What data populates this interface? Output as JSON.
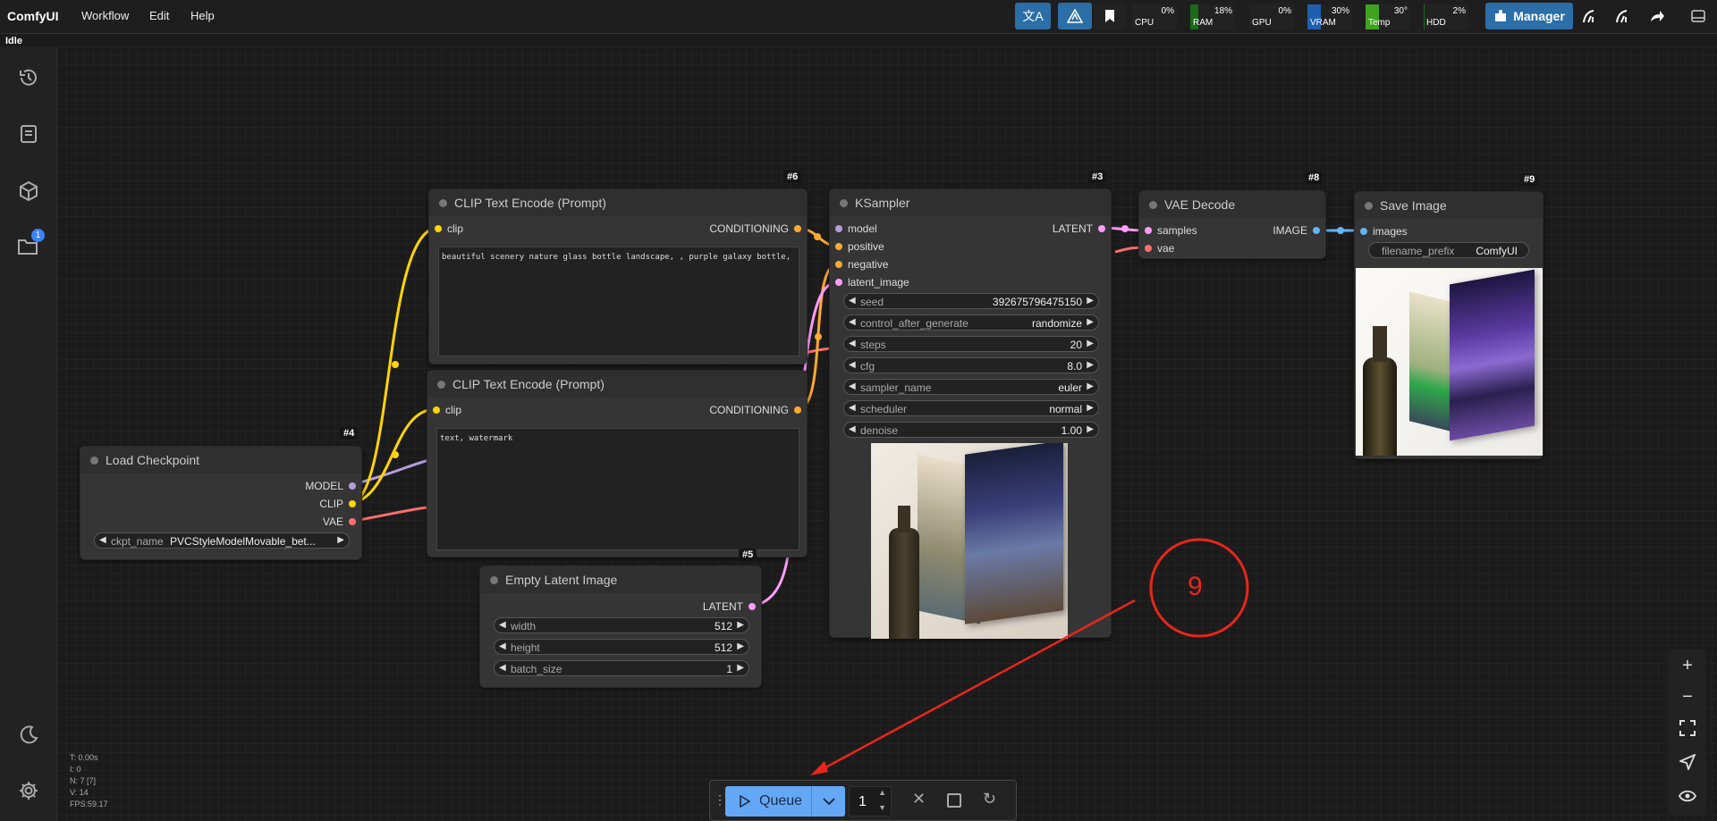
{
  "app": {
    "brand": "ComfyUI",
    "status": "Idle"
  },
  "menu": {
    "workflow": "Workflow",
    "edit": "Edit",
    "help": "Help"
  },
  "monitor": {
    "cpu": {
      "label": "CPU",
      "value": "0%",
      "level": 0.0,
      "color": "#1a7a1a"
    },
    "ram": {
      "label": "RAM",
      "value": "18%",
      "level": 0.18,
      "color": "#1a6a1a"
    },
    "gpu": {
      "label": "GPU",
      "value": "0%",
      "level": 0.0,
      "color": "#1a7a1a"
    },
    "vram": {
      "label": "VRAM",
      "value": "30%",
      "level": 0.3,
      "color": "#1e5fb0"
    },
    "temp": {
      "label": "Temp",
      "value": "30°",
      "level": 0.3,
      "color": "#3fa31f"
    },
    "hdd": {
      "label": "HDD",
      "value": "2%",
      "level": 0.02,
      "color": "#1a6a1a"
    }
  },
  "manager": {
    "label": "Manager"
  },
  "colors": {
    "clip": "#ffd500",
    "conditioning": "#ffa931",
    "model": "#b39ddb",
    "latent": "#ff9cf9",
    "vae": "#ff6e6e",
    "image": "#64b5f6",
    "annotation": "#e8261b",
    "queue": "#64a8f5"
  },
  "nodes": {
    "clip_pos": {
      "id": "#6",
      "title": "CLIP Text Encode (Prompt)",
      "in": "clip",
      "out": "CONDITIONING",
      "text": "beautiful scenery nature glass bottle landscape, , purple galaxy bottle,"
    },
    "clip_neg": {
      "id": "#7",
      "title": "CLIP Text Encode (Prompt)",
      "in": "clip",
      "out": "CONDITIONING",
      "text": "text, watermark"
    },
    "ckpt": {
      "id": "#4",
      "title": "Load Checkpoint",
      "out_model": "MODEL",
      "out_clip": "CLIP",
      "out_vae": "VAE",
      "w_label": "ckpt_name",
      "w_value": "PVCStyleModelMovable_bet..."
    },
    "latent": {
      "id": "#5",
      "title": "Empty Latent Image",
      "out": "LATENT",
      "width_label": "width",
      "width": "512",
      "height_label": "height",
      "height": "512",
      "batch_label": "batch_size",
      "batch": "1"
    },
    "ksampler": {
      "id": "#3",
      "title": "KSampler",
      "in_model": "model",
      "in_positive": "positive",
      "in_negative": "negative",
      "in_latent": "latent_image",
      "out": "LATENT",
      "widgets": [
        {
          "label": "seed",
          "value": "392675796475150"
        },
        {
          "label": "control_after_generate",
          "value": "randomize"
        },
        {
          "label": "steps",
          "value": "20"
        },
        {
          "label": "cfg",
          "value": "8.0"
        },
        {
          "label": "sampler_name",
          "value": "euler"
        },
        {
          "label": "scheduler",
          "value": "normal"
        },
        {
          "label": "denoise",
          "value": "1.00"
        }
      ]
    },
    "vae": {
      "id": "#8",
      "title": "VAE Decode",
      "in_samples": "samples",
      "in_vae": "vae",
      "out": "IMAGE"
    },
    "save": {
      "id": "#9",
      "title": "Save Image",
      "in": "images",
      "w_label": "filename_prefix",
      "w_value": "ComfyUI"
    }
  },
  "annotation": {
    "number": "9"
  },
  "queue": {
    "label": "Queue",
    "count": "1"
  },
  "stats": {
    "t": "T: 0.00s",
    "i": "I: 0",
    "n": "N: 7 [7]",
    "v": "V: 14",
    "fps": "FPS:59.17"
  }
}
